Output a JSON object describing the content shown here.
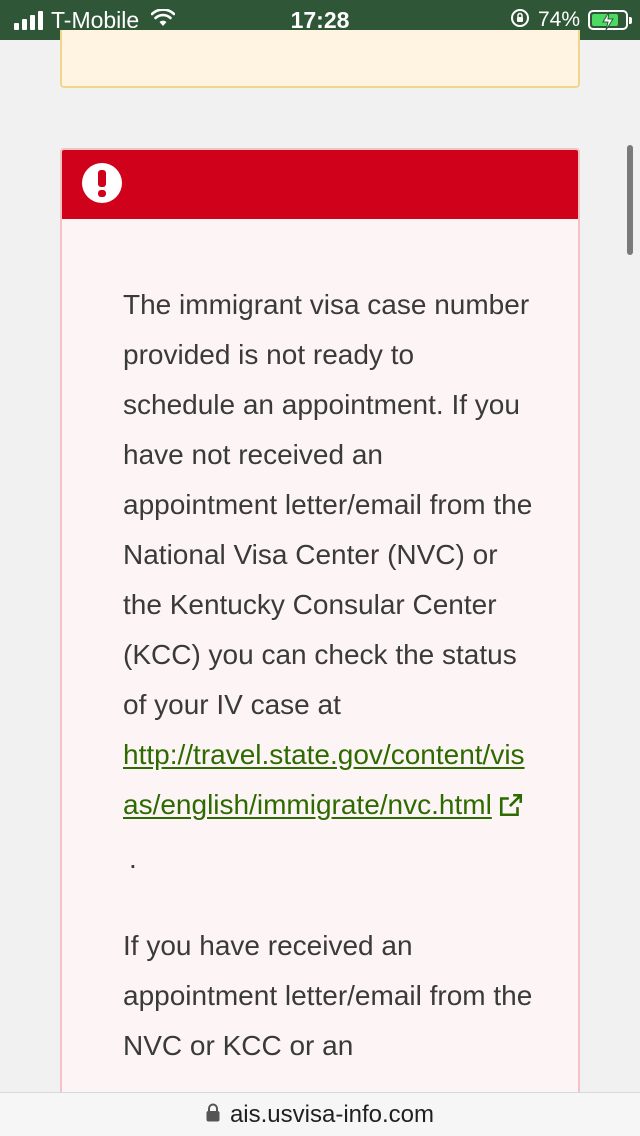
{
  "status_bar": {
    "carrier": "T-Mobile",
    "time": "17:28",
    "battery_percent": "74%",
    "battery_level": 0.74,
    "icons": [
      "signal-icon",
      "wifi-icon",
      "orientation-lock-icon",
      "battery-charging-icon"
    ]
  },
  "error_alert": {
    "icon": "exclamation-icon",
    "header_color": "#d0021b",
    "paragraph1_text": "The immigrant visa case number provided is not ready to schedule an appointment. If you have not received an appointment letter/email from the National Visa Center (NVC) or the Kentucky Consular Center (KCC) you can check the status of your IV case at",
    "link_text": "http://travel.state.gov/content/visas/english/immigrate/nvc.html",
    "link_suffix": ".",
    "link_color": "#2d6a00",
    "paragraph2_text": "If you have received an appointment letter/email from the NVC or KCC or an"
  },
  "url_bar": {
    "url": "ais.usvisa-info.com",
    "icon": "lock-icon"
  }
}
